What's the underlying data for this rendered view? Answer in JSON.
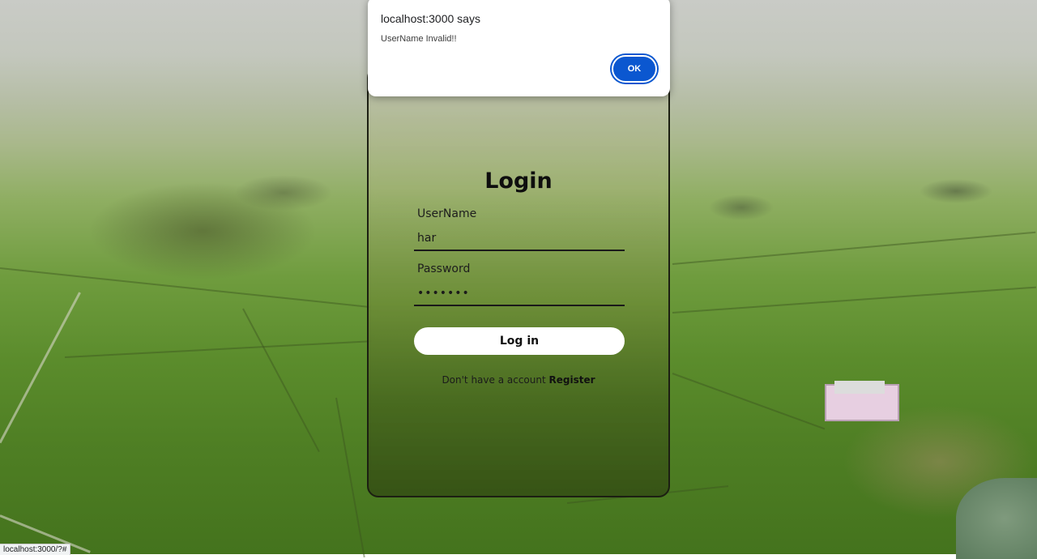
{
  "dialog": {
    "title": "localhost:3000 says",
    "message": "UserName Invalid!!",
    "ok_label": "OK"
  },
  "login": {
    "title": "Login",
    "username_label": "UserName",
    "username_value": "har",
    "password_label": "Password",
    "password_value": "•••••••",
    "submit_label": "Log in",
    "register_prompt": "Don't have a account",
    "register_link": "Register"
  },
  "status_bar": {
    "url": "localhost:3000/?#"
  },
  "colors": {
    "dialog_button": "#0b57d0",
    "card_border": "#1c1f12",
    "login_button_bg": "#ffffff"
  }
}
